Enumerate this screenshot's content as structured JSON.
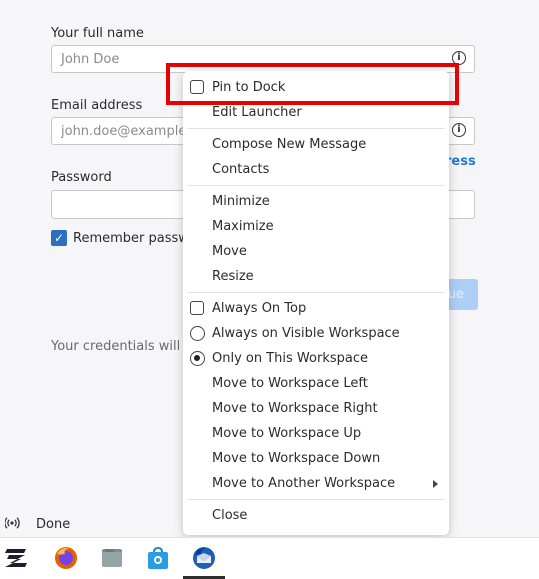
{
  "form": {
    "name_label": "Your full name",
    "name_placeholder": "John Doe",
    "email_label": "Email address",
    "email_placeholder": "john.doe@example.",
    "link_tail": "ress",
    "password_label": "Password",
    "remember_label": "Remember passw",
    "continue_label": "ue",
    "credentials_note": "Your credentials will"
  },
  "menu": {
    "pin_to_dock": "Pin to Dock",
    "edit_launcher": "Edit Launcher",
    "compose": "Compose New Message",
    "contacts": "Contacts",
    "minimize": "Minimize",
    "maximize": "Maximize",
    "move": "Move",
    "resize": "Resize",
    "always_on_top": "Always On Top",
    "always_visible": "Always on Visible Workspace",
    "only_this": "Only on This Workspace",
    "ws_left": "Move to Workspace Left",
    "ws_right": "Move to Workspace Right",
    "ws_up": "Move to Workspace Up",
    "ws_down": "Move to Workspace Down",
    "ws_another": "Move to Another Workspace",
    "close": "Close"
  },
  "status": {
    "text": "Done"
  },
  "dock": {
    "items": [
      "zorin-menu-icon",
      "firefox-icon",
      "files-icon",
      "software-store-icon",
      "thunderbird-icon"
    ]
  },
  "colors": {
    "highlight": "#e60000",
    "accent": "#2c6fbf",
    "link": "#1f7ad6"
  }
}
